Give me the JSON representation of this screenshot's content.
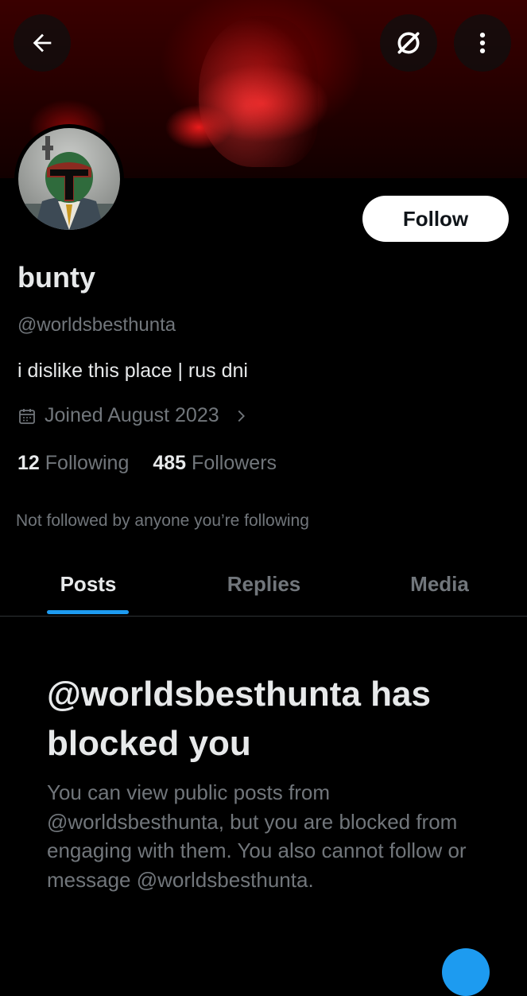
{
  "profile": {
    "display_name": "bunty",
    "handle": "@worldsbesthunta",
    "bio": "i dislike this place | rus dni",
    "joined": "Joined August 2023",
    "following_count": "12",
    "following_label": "Following",
    "followers_count": "485",
    "followers_label": "Followers",
    "not_followed_note": "Not followed by anyone you’re following"
  },
  "actions": {
    "follow_label": "Follow"
  },
  "tabs": [
    {
      "label": "Posts",
      "active": true
    },
    {
      "label": "Replies",
      "active": false
    },
    {
      "label": "Media",
      "active": false
    }
  ],
  "blocked": {
    "title": "@worldsbesthunta has blocked you",
    "body": "You can view public posts from @worldsbesthunta, but you are blocked from engaging with them. You also cannot follow or message @worldsbesthunta."
  },
  "icons": {
    "back": "arrow-left-icon",
    "grok": "grok-icon",
    "more": "more-vertical-icon",
    "calendar": "calendar-icon",
    "chevron": "chevron-right-icon"
  },
  "colors": {
    "background": "#000000",
    "text_primary": "#e7e9ea",
    "text_secondary": "#71767b",
    "accent": "#1d9bf0",
    "divider": "#2f3336"
  }
}
